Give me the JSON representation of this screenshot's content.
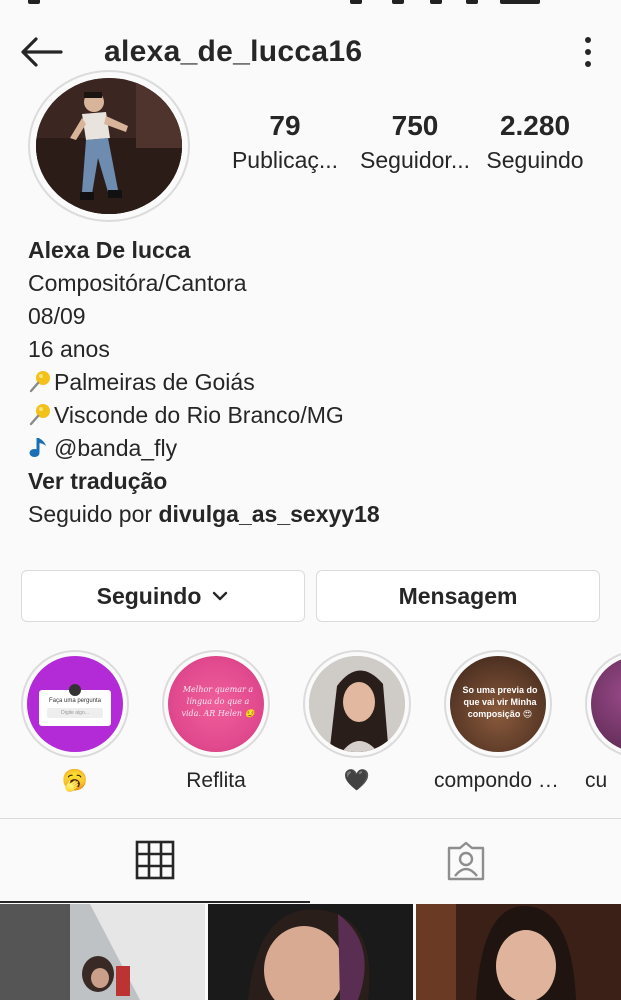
{
  "header": {
    "username": "alexa_de_lucca16",
    "back_icon": "arrow-left-icon",
    "more_icon": "more-vertical-icon"
  },
  "stats": [
    {
      "value": "79",
      "label": "Publicaç..."
    },
    {
      "value": "750",
      "label": "Seguidor..."
    },
    {
      "value": "2.280",
      "label": "Seguindo"
    }
  ],
  "bio": {
    "name": "Alexa De lucca",
    "lines": [
      "Compositóra/Cantora",
      "08/09",
      "16 anos"
    ],
    "location_1": "Palmeiras de Goiás",
    "location_2": "Visconde do Rio Branco/MG",
    "music": "@banda_fly",
    "translate": "Ver tradução",
    "followed_by_prefix": "Seguido por ",
    "followed_by_user": "divulga_as_sexyy18"
  },
  "actions": {
    "following_label": "Seguindo",
    "message_label": "Mensagem"
  },
  "highlights": [
    {
      "label": "🥱",
      "inner_title": "Faça uma pergunta",
      "inner_input": "Digite algo..."
    },
    {
      "label": "Reflita",
      "inner_text": "Melhor quemar a língua do que a vida. AR Helen 😏"
    },
    {
      "label": "🖤"
    },
    {
      "label": "compondo a...",
      "inner_text": "So uma previa do que vai vir Minha composição 😍"
    },
    {
      "label": "cu"
    }
  ],
  "tabs": {
    "grid_icon": "grid-icon",
    "tagged_icon": "tagged-person-icon"
  },
  "colors": {
    "accent_text": "#262626",
    "border": "#dbdbdb",
    "background": "#fafafa",
    "highlight_purple": "#b22bd6",
    "highlight_pink": "#e24b8f"
  }
}
